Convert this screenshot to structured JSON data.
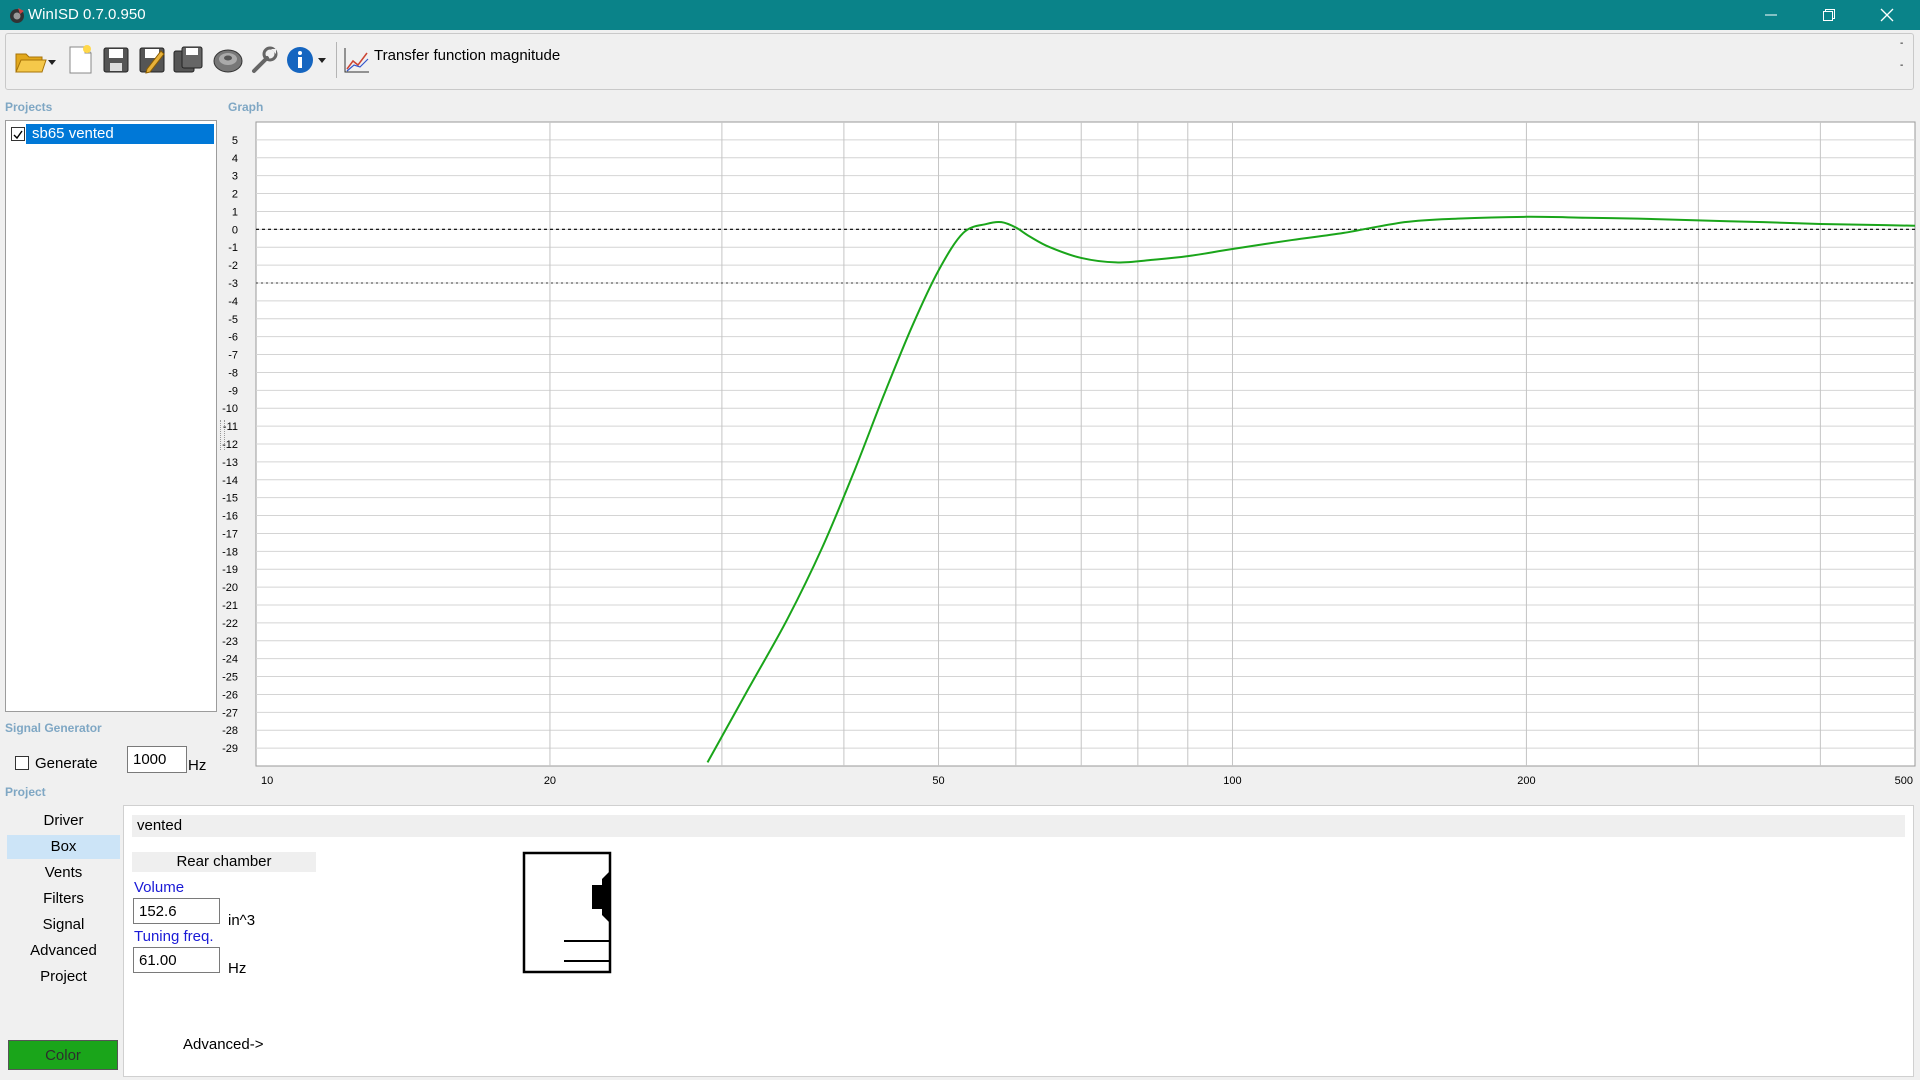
{
  "window": {
    "title": "WinISD 0.7.0.950"
  },
  "toolbar": {
    "icons": [
      "open-folder-icon",
      "new-file-icon",
      "save-icon",
      "save-as-icon",
      "save-all-icon",
      "driver-speaker-icon",
      "tools-wrench-icon",
      "info-icon"
    ],
    "graph_mode": "Transfer function magnitude"
  },
  "projects": {
    "label": "Projects",
    "items": [
      {
        "name": "sb65 vented",
        "checked": true
      }
    ]
  },
  "graph": {
    "label": "Graph",
    "line_color": "#1aa51a"
  },
  "chart_data": {
    "type": "line",
    "title": "",
    "xlabel": "",
    "ylabel": "",
    "x_scale": "log",
    "xlim": [
      10,
      500
    ],
    "ylim": [
      -30,
      6
    ],
    "x_ticks": [
      "10",
      "20",
      "50",
      "100",
      "200",
      "500"
    ],
    "y_ticks": [
      "5",
      "4",
      "3",
      "2",
      "1",
      "0",
      "-1",
      "-2",
      "-3",
      "-4",
      "-5",
      "-6",
      "-7",
      "-8",
      "-9",
      "-10",
      "-11",
      "-12",
      "-13",
      "-14",
      "-15",
      "-16",
      "-17",
      "-18",
      "-19",
      "-20",
      "-21",
      "-22",
      "-23",
      "-24",
      "-25",
      "-26",
      "-27",
      "-28",
      "-29"
    ],
    "reference_lines": [
      0,
      -3
    ],
    "grid": true,
    "series": [
      {
        "color": "#1aa51a",
        "x": [
          29,
          32,
          35,
          38,
          41,
          44,
          47,
          50,
          53,
          56,
          58,
          60,
          62,
          65,
          70,
          76,
          83,
          90,
          100,
          115,
          130,
          150,
          170,
          200,
          230,
          260,
          300,
          350,
          400,
          450,
          500
        ],
        "y": [
          -29.8,
          -25.6,
          -21.8,
          -17.8,
          -13.5,
          -9.2,
          -5.4,
          -2.3,
          -0.2,
          0.3,
          0.4,
          0.1,
          -0.4,
          -1.0,
          -1.6,
          -1.85,
          -1.7,
          -1.5,
          -1.1,
          -0.6,
          -0.2,
          0.4,
          0.6,
          0.7,
          0.65,
          0.6,
          0.5,
          0.4,
          0.3,
          0.25,
          0.2
        ]
      }
    ]
  },
  "signal_generator": {
    "label": "Signal Generator",
    "generate_label": "Generate",
    "generate_checked": false,
    "frequency": "1000",
    "unit": "Hz"
  },
  "project": {
    "label": "Project",
    "nav": [
      "Driver",
      "Box",
      "Vents",
      "Filters",
      "Signal",
      "Advanced",
      "Project"
    ],
    "active_nav": "Box",
    "color_button": "Color",
    "box_type": "vented",
    "rear_chamber_label": "Rear chamber",
    "volume_label": "Volume",
    "volume": "152.6",
    "volume_unit": "in^3",
    "tuning_label": "Tuning freq.",
    "tuning": "61.00",
    "tuning_unit": "Hz",
    "advanced_link": "Advanced->",
    "color_swatch": "#1aa51a"
  }
}
